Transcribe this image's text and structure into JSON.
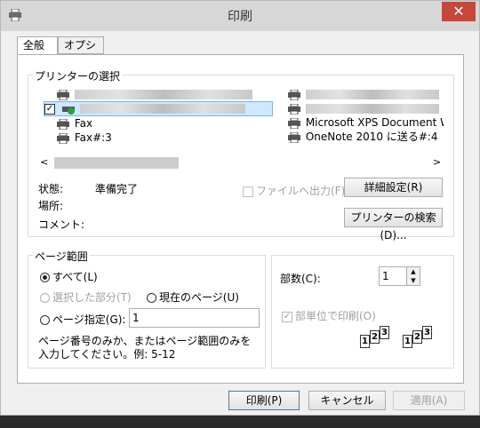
{
  "window": {
    "title": "印刷",
    "close_glyph": "✕"
  },
  "tabs": [
    {
      "label": "全般",
      "active": true
    },
    {
      "label": "オプション",
      "active": false
    }
  ],
  "printer_select": {
    "group_label": "プリンターの選択",
    "printers_left": [
      "",
      "",
      "Fax",
      "Fax#:3"
    ],
    "printers_right": [
      "",
      "",
      "Microsoft XPS Document W",
      "OneNote 2010 に送る#:4"
    ],
    "status_label": "状態:",
    "status_value": "準備完了",
    "location_label": "場所:",
    "comment_label": "コメント:",
    "print_to_file_label": "ファイルへ出力(F)",
    "preferences_button": "詳細設定(R)",
    "find_printer_button": "プリンターの検索(D)..."
  },
  "page_range": {
    "group_label": "ページ範囲",
    "all_label": "すべて(L)",
    "selection_label": "選択した部分(T)",
    "current_page_label": "現在のページ(U)",
    "pages_label": "ページ指定(G):",
    "pages_value": "1",
    "hint": "ページ番号のみか、またはページ範囲のみを入力してください。例: 5-12"
  },
  "copies": {
    "label": "部数(C):",
    "value": "1",
    "collate_label": "部単位で印刷(O)",
    "collate_checked": true,
    "collate_pages": [
      "1",
      "2",
      "3",
      "1",
      "2",
      "3"
    ]
  },
  "footer": {
    "print": "印刷(P)",
    "cancel": "キャンセル",
    "apply": "適用(A)"
  }
}
